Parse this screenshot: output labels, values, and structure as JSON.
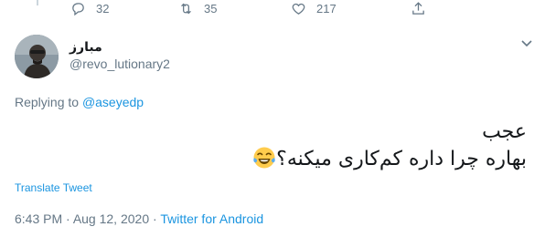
{
  "actions": {
    "reply_count": "32",
    "retweet_count": "35",
    "like_count": "217"
  },
  "author": {
    "display_name": "مبارز",
    "handle": "@revo_lutionary2"
  },
  "replying": {
    "prefix": "Replying to",
    "mention": "@aseyedp"
  },
  "tweet": {
    "line1": "عجب",
    "line2": "بهاره چرا داره کم‌کاری میکنه؟",
    "emoji_icon": "face-with-tears-of-joy"
  },
  "translate_label": "Translate Tweet",
  "meta": {
    "time": "6:43 PM",
    "separator1": " · ",
    "date": "Aug 12, 2020",
    "separator2": " · ",
    "source": "Twitter for Android"
  },
  "colors": {
    "link": "#1b95e0",
    "secondary": "#657786",
    "text": "#14171a"
  }
}
